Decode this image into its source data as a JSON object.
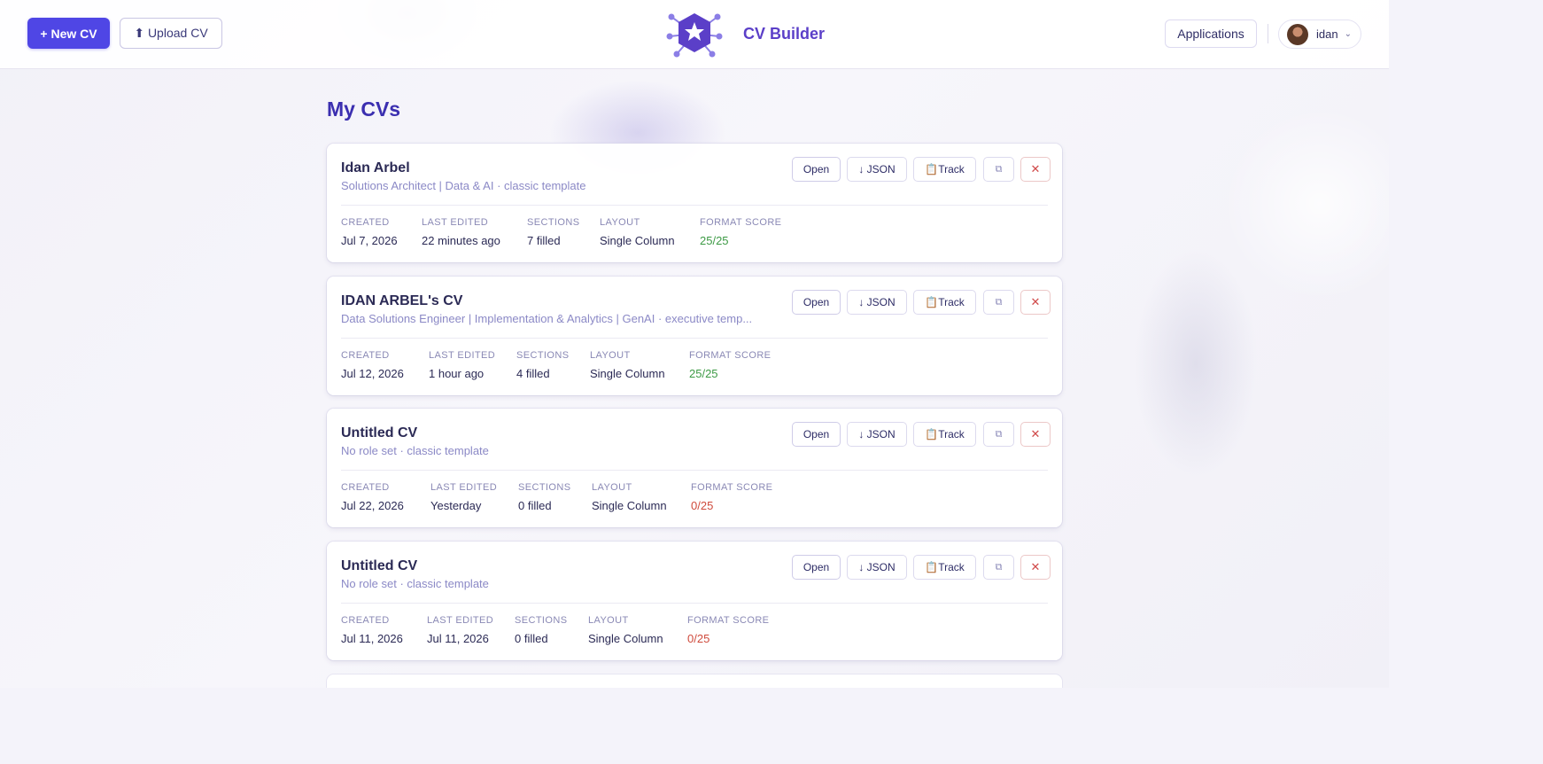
{
  "header": {
    "new_cv_label": "+ New CV",
    "upload_cv_label": "⬆ Upload CV",
    "brand": "CV Builder",
    "applications_label": "Applications",
    "user_name": "idan"
  },
  "page_title": "My CVs",
  "actions": {
    "open": "Open",
    "json": "↓ JSON",
    "track": "📋Track",
    "duplicate": "⧉",
    "delete": "✕"
  },
  "meta_labels": {
    "created": "CREATED",
    "last_edited": "LAST EDITED",
    "sections": "SECTIONS",
    "layout": "LAYOUT",
    "format_score": "FORMAT SCORE"
  },
  "cvs": [
    {
      "title": "Idan Arbel",
      "subtitle": "Solutions Architect | Data & AI · classic template",
      "created": "Jul 7, 2026",
      "last_edited": "22 minutes ago",
      "sections": "7 filled",
      "layout": "Single Column",
      "format_score": "25/25",
      "score_status": "good"
    },
    {
      "title": "IDAN ARBEL's CV",
      "subtitle": "Data Solutions Engineer | Implementation & Analytics | GenAI · executive temp...",
      "created": "Jul 12, 2026",
      "last_edited": "1 hour ago",
      "sections": "4 filled",
      "layout": "Single Column",
      "format_score": "25/25",
      "score_status": "good"
    },
    {
      "title": "Untitled CV",
      "subtitle": "No role set · classic template",
      "created": "Jul 22, 2026",
      "last_edited": "Yesterday",
      "sections": "0 filled",
      "layout": "Single Column",
      "format_score": "0/25",
      "score_status": "bad"
    },
    {
      "title": "Untitled CV",
      "subtitle": "No role set · classic template",
      "created": "Jul 11, 2026",
      "last_edited": "Jul 11, 2026",
      "sections": "0 filled",
      "layout": "Single Column",
      "format_score": "0/25",
      "score_status": "bad"
    }
  ],
  "colors": {
    "accent": "#4f46e5",
    "brand": "#5b3fc8",
    "score_good": "#3d9a45",
    "score_bad": "#cf4a3c"
  }
}
